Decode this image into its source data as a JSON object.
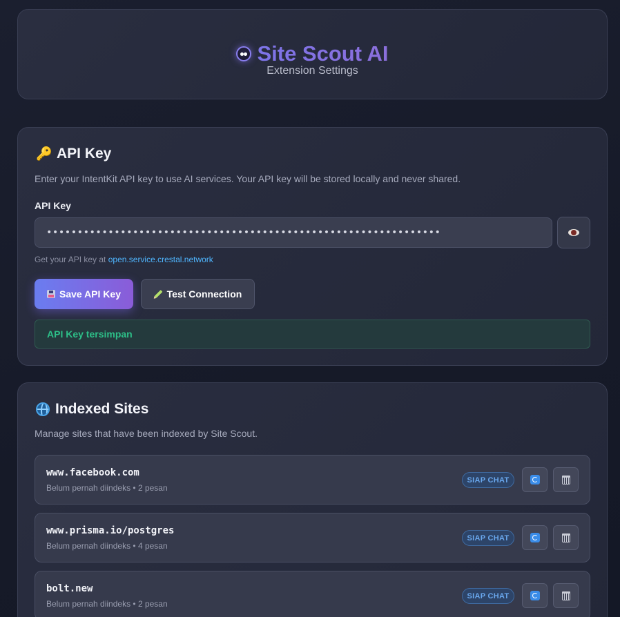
{
  "header": {
    "title": "Site Scout AI",
    "subtitle": "Extension Settings",
    "logo_icon": "robot-face-icon"
  },
  "api_section": {
    "icon": "key-icon",
    "title": "API Key",
    "description": "Enter your IntentKit API key to use AI services. Your API key will be stored locally and never shared.",
    "field_label": "API Key",
    "input_value": "••••••••••••••••••••••••••••••••••••••••••••••••••••••••••••••••",
    "toggle_icon": "eye-icon",
    "hint_prefix": "Get your API key at",
    "hint_link": "open.service.crestal.network",
    "save_label": "Save API Key",
    "test_label": "Test Connection",
    "status_text": "API Key tersimpan",
    "status_color": "#2dbf88"
  },
  "sites_section": {
    "icon": "globe-icon",
    "title": "Indexed Sites",
    "description": "Manage sites that have been indexed by Site Scout.",
    "sites": [
      {
        "name": "www.facebook.com",
        "meta": "Belum pernah diindeks • 2 pesan",
        "badge": "SIAP CHAT"
      },
      {
        "name": "www.prisma.io/postgres",
        "meta": "Belum pernah diindeks • 4 pesan",
        "badge": "SIAP CHAT"
      },
      {
        "name": "bolt.new",
        "meta": "Belum pernah diindeks • 2 pesan",
        "badge": "SIAP CHAT"
      }
    ]
  },
  "colors": {
    "accent": "#7b6fe0",
    "link": "#4fb6ff",
    "badge": "#6aa8ee"
  }
}
